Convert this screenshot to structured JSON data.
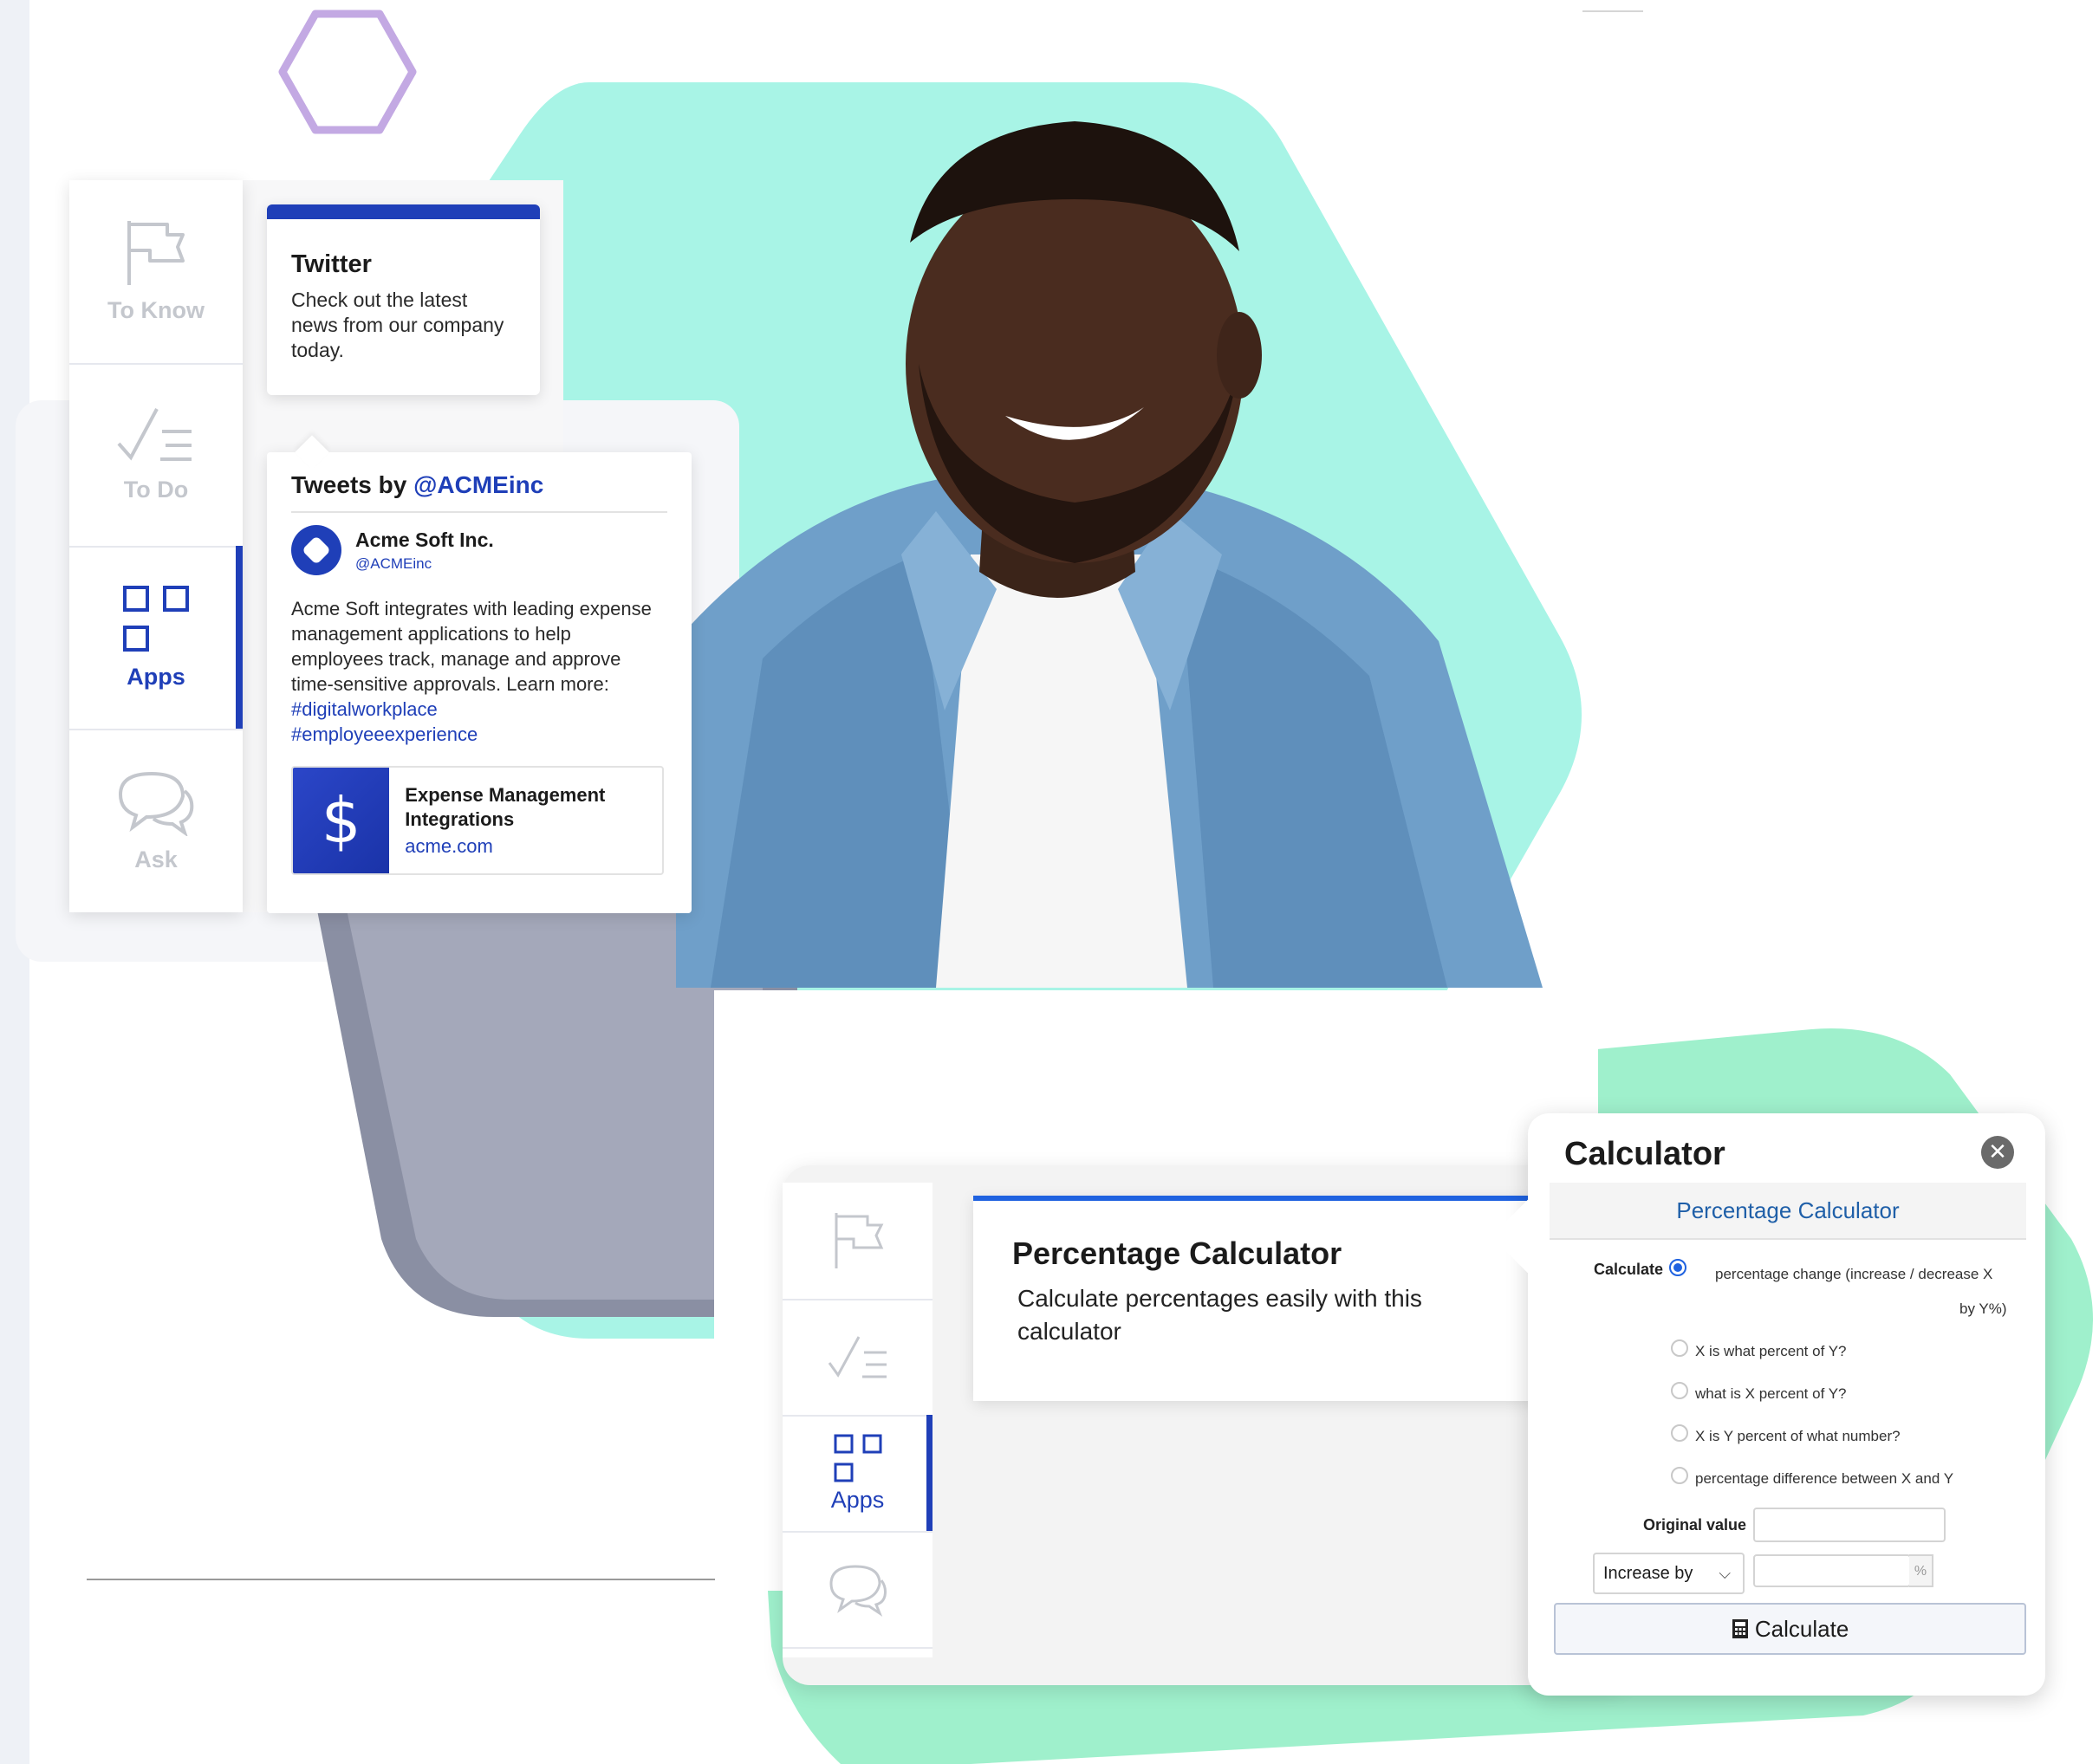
{
  "sidebar_primary": {
    "items": [
      {
        "label": "To Know",
        "icon": "flag-icon"
      },
      {
        "label": "To Do",
        "icon": "checklist-icon"
      },
      {
        "label": "Apps",
        "icon": "apps-grid-icon",
        "active": true
      },
      {
        "label": "Ask",
        "icon": "chat-bubbles-icon"
      }
    ]
  },
  "twitter_card": {
    "title": "Twitter",
    "description": "Check out the latest news from our company today."
  },
  "tweets": {
    "heading_prefix": "Tweets by ",
    "heading_handle": "@ACMEinc",
    "account_name": "Acme Soft Inc.",
    "account_handle": "@ACMEinc",
    "body": "Acme Soft integrates with leading expense management applications to help employees track, manage and approve time-sensitive approvals.",
    "learn_more": "Learn more: ",
    "tag1": "#digitalworkplace",
    "tag2": "#employeeexperience",
    "link_card": {
      "thumb_symbol": "$",
      "title": "Expense Management Integrations",
      "domain": "acme.com"
    }
  },
  "sidebar_secondary": {
    "items": [
      {
        "icon": "flag-icon"
      },
      {
        "icon": "checklist-icon"
      },
      {
        "label": "Apps",
        "icon": "apps-grid-icon",
        "active": true
      },
      {
        "icon": "chat-bubbles-icon"
      }
    ]
  },
  "percentage_card": {
    "title": "Percentage Calculator",
    "description": "Calculate percentages easily with this calculator"
  },
  "calculator": {
    "title": "Calculator",
    "close_symbol": "✕",
    "subtitle": "Percentage Calculator",
    "calculate_label": "Calculate",
    "options": [
      {
        "line1": "percentage change (increase / decrease X",
        "line2": "by Y%)",
        "selected": true
      },
      {
        "line1": "X is what percent of Y?"
      },
      {
        "line1": "what is X percent of Y?"
      },
      {
        "line1": "X is Y percent of what number?"
      },
      {
        "line1": "percentage difference between X and Y"
      }
    ],
    "original_value_label": "Original value",
    "original_value": "",
    "mode_select": "Increase by",
    "percent_value": "",
    "percent_symbol": "%",
    "button_label": "Calculate",
    "button_icon": "calculator-icon"
  },
  "colors": {
    "brand_blue": "#1f3fb8",
    "teal_accent": "#a8f4e6",
    "mint_accent": "#9ff0cc",
    "lavender_hex": "#c3a9e3"
  }
}
